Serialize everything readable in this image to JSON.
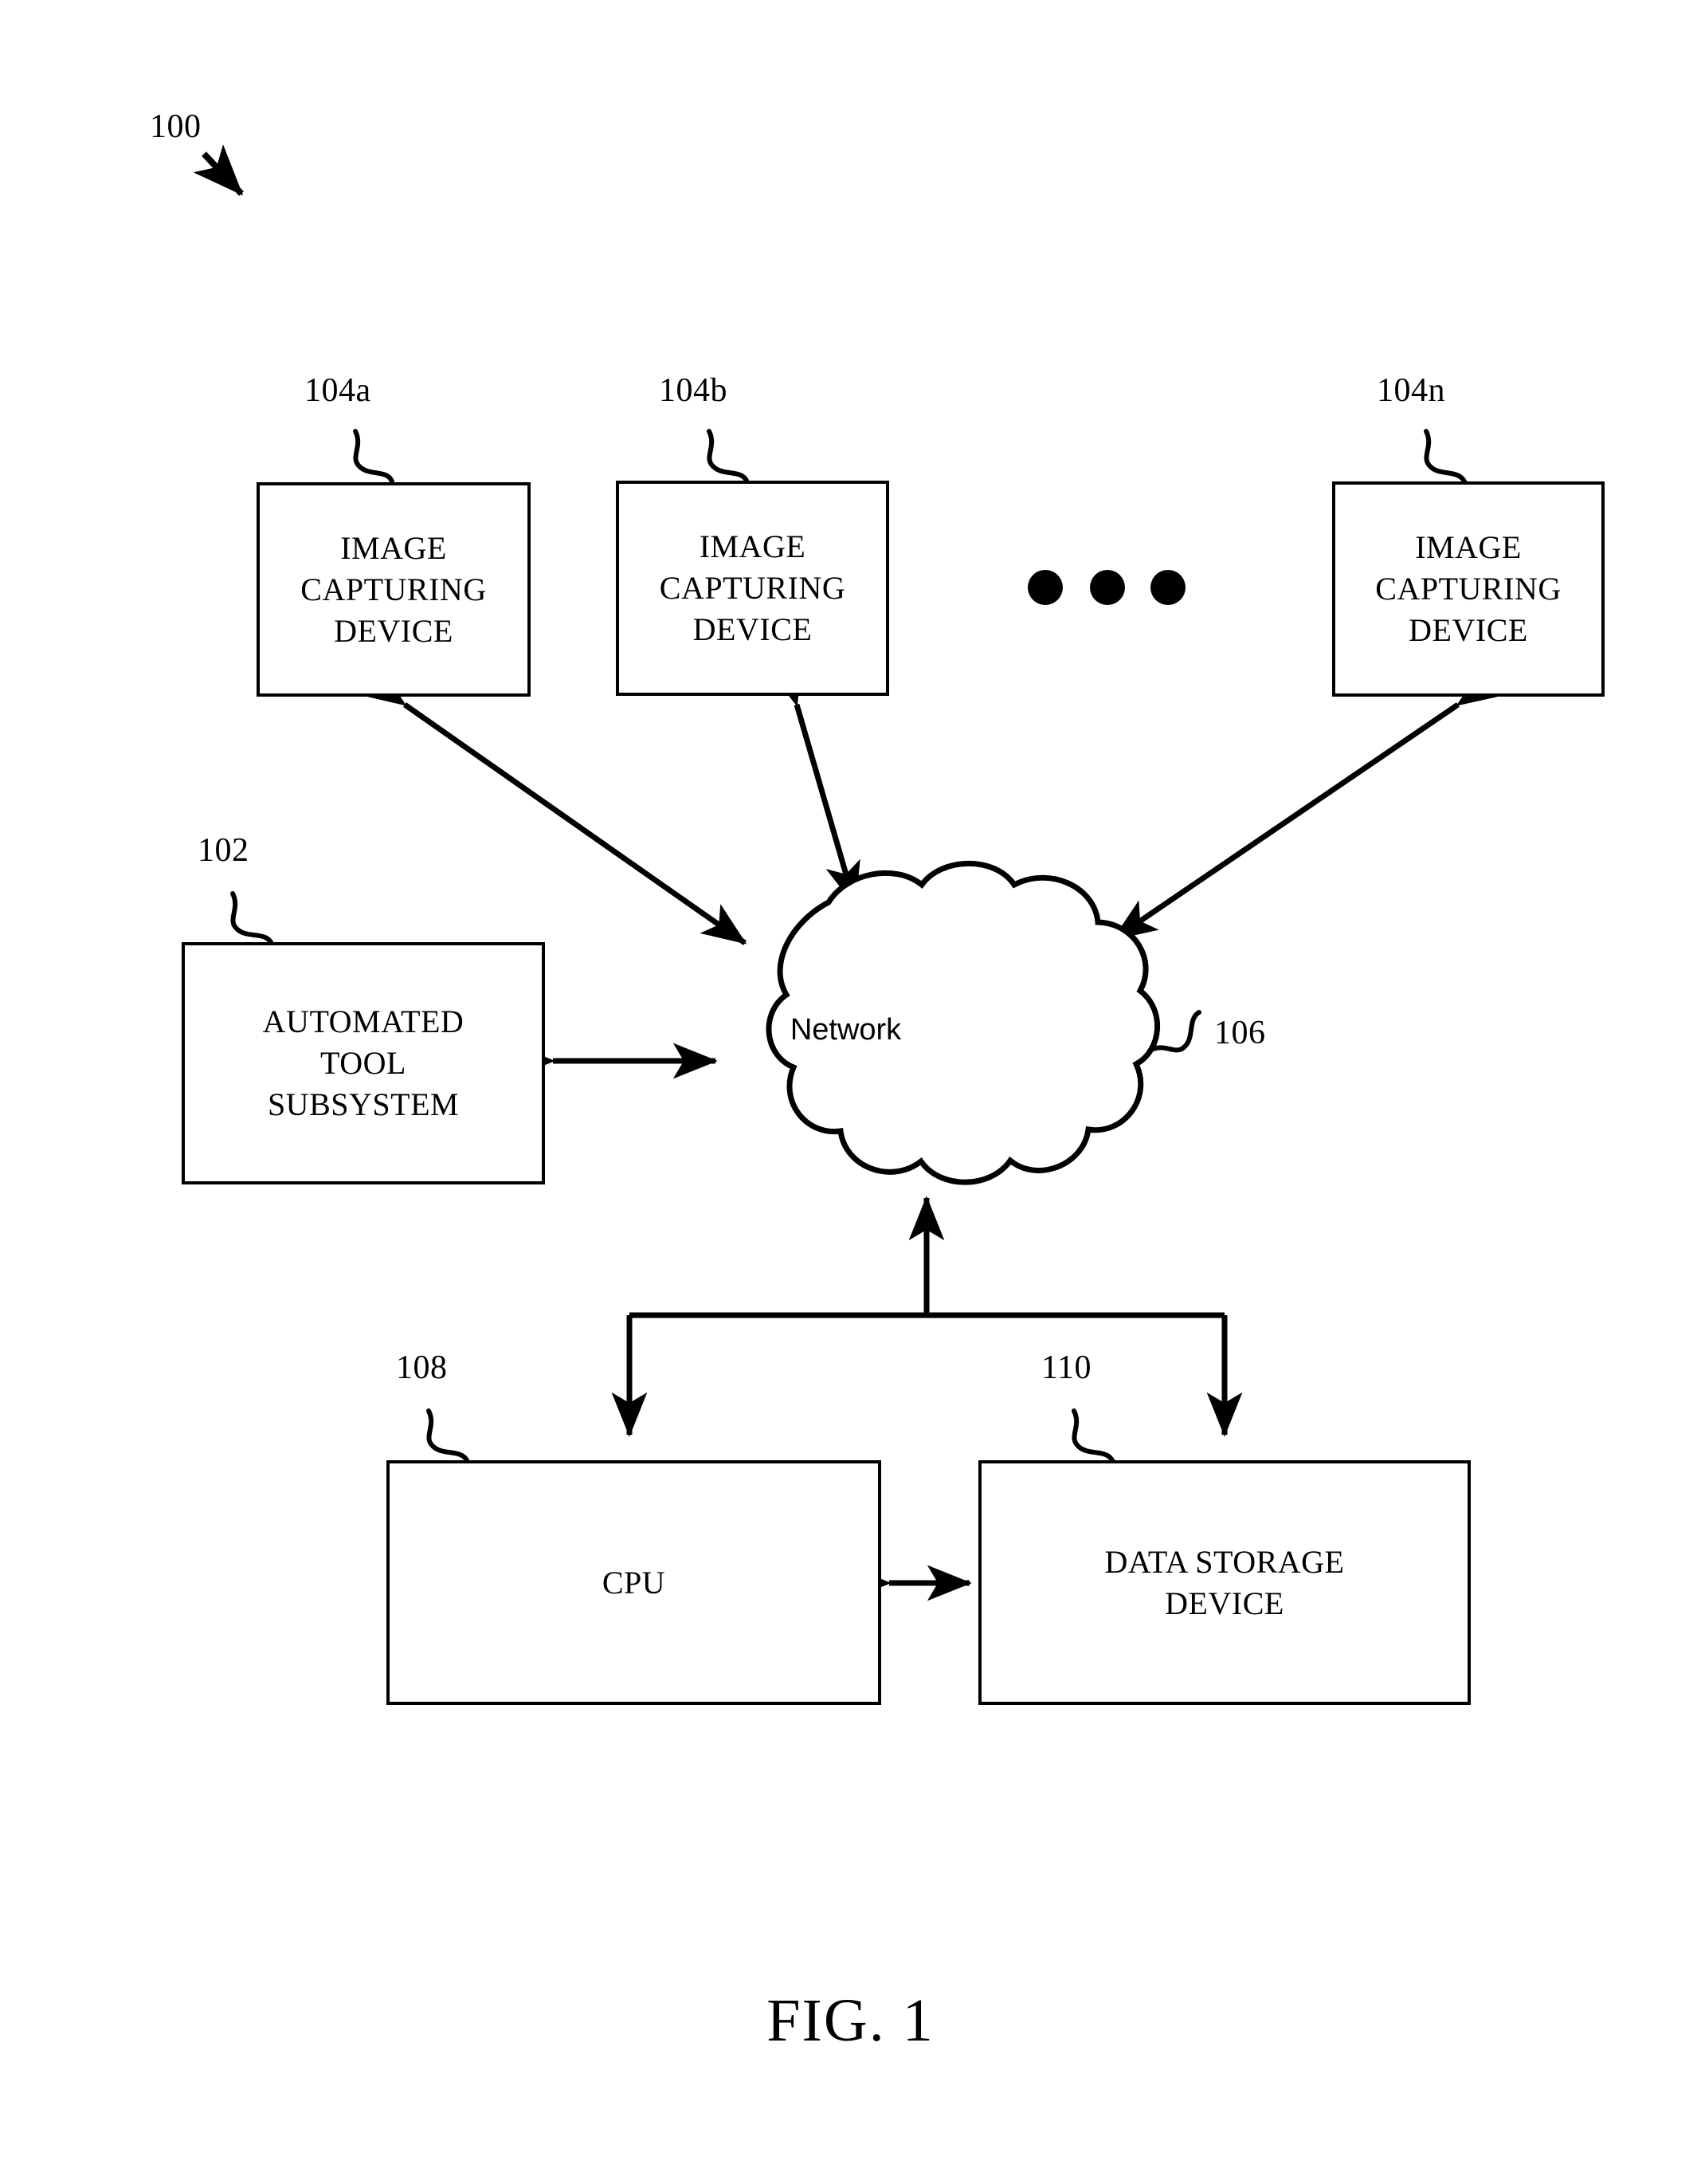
{
  "figure": {
    "caption": "FIG. 1",
    "system_ref": "100"
  },
  "nodes": [
    {
      "ref": "104a",
      "label_lines": [
        "IMAGE",
        "CAPTURING",
        "DEVICE"
      ],
      "name": "image-capturing-device-a"
    },
    {
      "ref": "104b",
      "label_lines": [
        "IMAGE",
        "CAPTURING",
        "DEVICE"
      ],
      "name": "image-capturing-device-b"
    },
    {
      "ref": "104n",
      "label_lines": [
        "IMAGE",
        "CAPTURING",
        "DEVICE"
      ],
      "name": "image-capturing-device-n"
    },
    {
      "ref": "102",
      "label_lines": [
        "AUTOMATED",
        "TOOL",
        "SUBSYSTEM"
      ],
      "name": "automated-tool-subsystem"
    },
    {
      "ref": "106",
      "label_lines": [
        "Network"
      ],
      "name": "network-cloud"
    },
    {
      "ref": "108",
      "label_lines": [
        "CPU"
      ],
      "name": "cpu"
    },
    {
      "ref": "110",
      "label_lines": [
        "DATA STORAGE",
        "DEVICE"
      ],
      "name": "data-storage-device"
    }
  ],
  "ellipsis": {
    "glyph": "•••",
    "count": 3
  },
  "colors": {
    "ink": "#000000",
    "paper": "#ffffff"
  }
}
